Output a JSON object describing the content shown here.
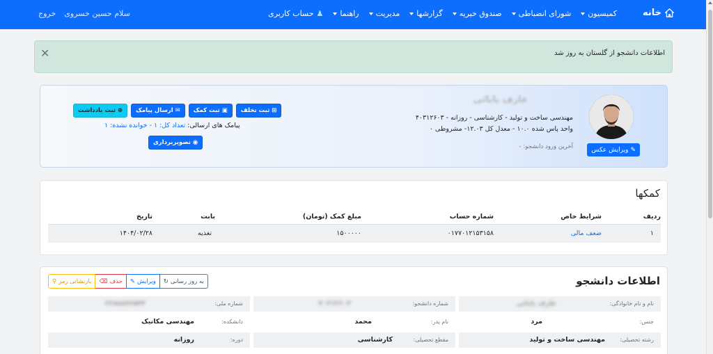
{
  "navbar": {
    "brand": "خانه",
    "menu": [
      {
        "label": "کمیسیون"
      },
      {
        "label": "شورای انضباطی"
      },
      {
        "label": "صندوق خیریه"
      },
      {
        "label": "گزارشها"
      },
      {
        "label": "مدیریت"
      },
      {
        "label": "راهنما"
      }
    ],
    "account": "حساب کاربری",
    "greeting": "سلام حسین خسروی",
    "logout": "خروج"
  },
  "alert": {
    "text": "اطلاعات دانشجو از گلستان به روز شد"
  },
  "profile": {
    "name": "عارف بابائی",
    "line1": "مهندسی ساخت و تولید - کارشناسی - روزانه - ۴۰۳۱۲۶۰۳",
    "line2": "واحد پاس شده ۱۰.۰ - معدل کل ۱۲.۰۳- مشروطی ۰",
    "last_login": "آخرین ورود دانشجو: -",
    "edit_photo": "ویرایش عکس",
    "actions": {
      "violation": "ثبت تخلف",
      "aid": "ثبت کمک",
      "send_sms": "ارسال پیامک",
      "note": "ثبت یادداشت",
      "screenshot": "تصویربرداری"
    },
    "sms": {
      "label": "پیامک های ارسالی:",
      "total": "تعداد کل: ۱",
      "separator": "-",
      "unread": "خوانده نشده: ۱"
    }
  },
  "aids": {
    "title": "کمکها",
    "headers": [
      "ردیف",
      "شرایط خاص",
      "شماره حساب",
      "مبلغ کمک (تومان)",
      "بابت",
      "تاریخ"
    ],
    "rows": [
      {
        "index": "۱",
        "condition": "ضعف مالی",
        "account": "۰۱۷۷۰۱۲۱۵۳۱۵۸",
        "amount": "۱۵۰۰۰۰۰",
        "for": "تغذیه",
        "date": "۱۴۰۴/۰۲/۲۸"
      }
    ]
  },
  "info": {
    "title": "اطلاعات دانشجو",
    "buttons": {
      "refresh": "به روز رسانی",
      "edit": "ویرایش",
      "delete": "حذف",
      "reset_password": "بازنشانی رمز"
    },
    "fields": {
      "fullname_label": "نام و نام خانوادگی:",
      "fullname_value": "عارف بابائی",
      "student_no_label": "شماره دانشجو:",
      "student_no_value": "۴۰۳۱۲۶۰۳",
      "national_id_label": "شماره ملی:",
      "national_id_value": "۲۲۸۸۸۷۶۵۴۳",
      "gender_label": "جنس:",
      "gender_value": "مرد",
      "father_label": "نام پدر:",
      "father_value": "محمد",
      "faculty_label": "دانشکده:",
      "faculty_value": "مهندسی مکانیک",
      "major_label": "رشته تحصیلی:",
      "major_value": "مهندسی ساخت و تولید",
      "level_label": "مقطع تحصیلی:",
      "level_value": "کارشناسی",
      "course_label": "دوره:",
      "course_value": "روزانه"
    }
  }
}
